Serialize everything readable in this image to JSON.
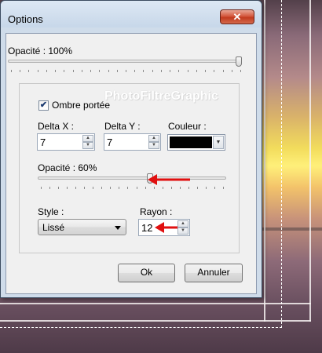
{
  "window": {
    "title": "Options",
    "close_label": "✕"
  },
  "opacity_top": {
    "label": "Opacité : 100%",
    "value_percent": 100
  },
  "watermark": "PhotoFiltreGraphic",
  "shadow": {
    "checkbox_label": "Ombre portée",
    "checked": true,
    "delta_x_label": "Delta X :",
    "delta_x_value": "7",
    "delta_y_label": "Delta Y :",
    "delta_y_value": "7",
    "color_label": "Couleur :",
    "color_value": "#000000",
    "opacity_label": "Opacité : 60%",
    "opacity_percent": 60,
    "style_label": "Style :",
    "style_value": "Lissé",
    "radius_label": "Rayon :",
    "radius_value": "12"
  },
  "buttons": {
    "ok_label": "Ok",
    "cancel_label": "Annuler"
  },
  "colors": {
    "annotation_arrow": "#e01010",
    "close_button": "#c23a1e"
  }
}
